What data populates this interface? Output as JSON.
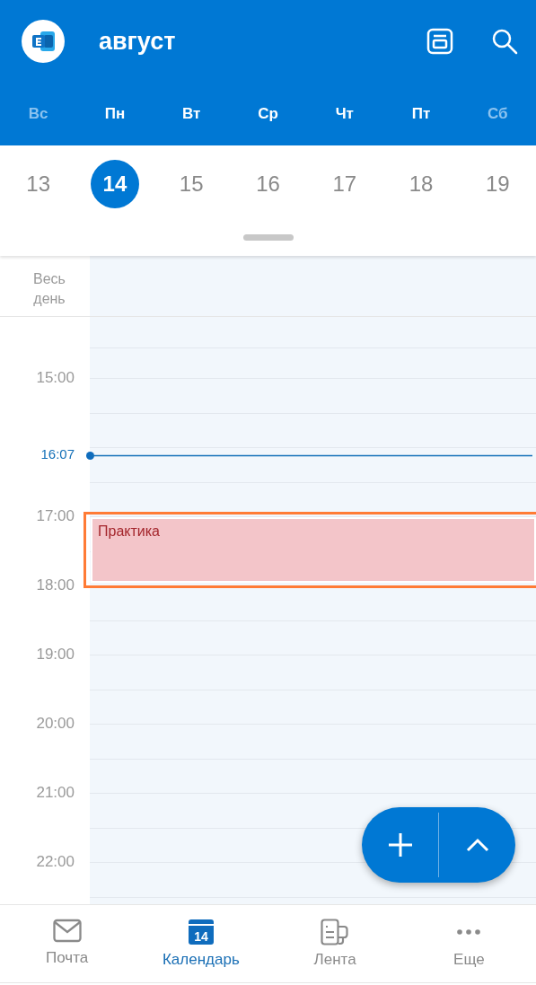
{
  "header": {
    "title": "август"
  },
  "weekdays": [
    {
      "label": "Вс",
      "weekend": true
    },
    {
      "label": "Пн",
      "weekend": false
    },
    {
      "label": "Вт",
      "weekend": false
    },
    {
      "label": "Ср",
      "weekend": false
    },
    {
      "label": "Чт",
      "weekend": false
    },
    {
      "label": "Пт",
      "weekend": false
    },
    {
      "label": "Сб",
      "weekend": true
    }
  ],
  "dates": [
    {
      "label": "13",
      "selected": false
    },
    {
      "label": "14",
      "selected": true
    },
    {
      "label": "15",
      "selected": false
    },
    {
      "label": "16",
      "selected": false
    },
    {
      "label": "17",
      "selected": false
    },
    {
      "label": "18",
      "selected": false
    },
    {
      "label": "19",
      "selected": false
    }
  ],
  "all_day": {
    "label": "Весь день"
  },
  "timeline": [
    {
      "kind": "hour",
      "label": "15:00"
    },
    {
      "kind": "now",
      "label": "16:07"
    },
    {
      "kind": "hour",
      "label": "17:00",
      "event": {
        "title": "Практика",
        "highlighted": true
      }
    },
    {
      "kind": "hour",
      "label": "18:00"
    },
    {
      "kind": "hour",
      "label": "19:00"
    },
    {
      "kind": "hour",
      "label": "20:00"
    },
    {
      "kind": "hour",
      "label": "21:00"
    },
    {
      "kind": "hour",
      "label": "22:00"
    }
  ],
  "bottom_nav": [
    {
      "kind": "mail",
      "label": "Почта",
      "selected": false
    },
    {
      "kind": "calendar",
      "label": "Календарь",
      "selected": true,
      "icon_text": "14"
    },
    {
      "kind": "feed",
      "label": "Лента",
      "selected": false
    },
    {
      "kind": "more",
      "label": "Еще",
      "selected": false
    }
  ]
}
